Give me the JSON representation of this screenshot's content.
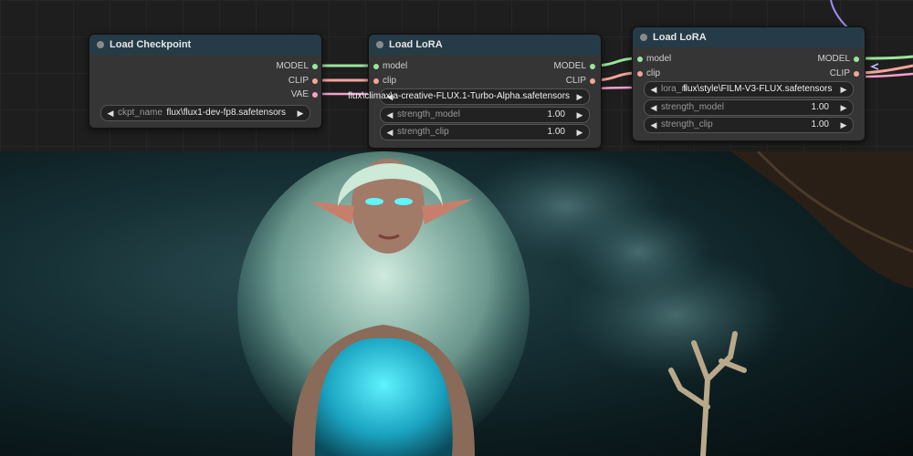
{
  "nodes": {
    "checkpoint": {
      "title": "Load Checkpoint",
      "outputs": {
        "model": "MODEL",
        "clip": "CLIP",
        "vae": "VAE"
      },
      "ckpt_label": "ckpt_name",
      "ckpt_value": "flux\\flux1-dev-fp8.safetensors"
    },
    "lora1": {
      "title": "Load LoRA",
      "inputs": {
        "model": "model",
        "clip": "clip"
      },
      "outputs": {
        "model": "MODEL",
        "clip": "CLIP"
      },
      "lora_value": "flux\\climax\\a-creative-FLUX.1-Turbo-Alpha.safetensors",
      "strength_model_label": "strength_model",
      "strength_model_value": "1.00",
      "strength_clip_label": "strength_clip",
      "strength_clip_value": "1.00"
    },
    "lora2": {
      "title": "Load LoRA",
      "inputs": {
        "model": "model",
        "clip": "clip"
      },
      "outputs": {
        "model": "MODEL",
        "clip": "CLIP"
      },
      "lora_label": "lora_n",
      "lora_value": "flux\\style\\FILM-V3-FLUX.safetensors",
      "strength_model_label": "strength_model",
      "strength_model_value": "1.00",
      "strength_clip_label": "strength_clip",
      "strength_clip_value": "1.00"
    }
  },
  "colors": {
    "model_wire": "#9be59b",
    "clip_wire": "#f4a59a",
    "vae_wire": "#f6a0cc",
    "node_header": "#253b48",
    "node_body": "#353535"
  },
  "icons": {
    "arrow_left": "◀",
    "arrow_right": "▶"
  }
}
